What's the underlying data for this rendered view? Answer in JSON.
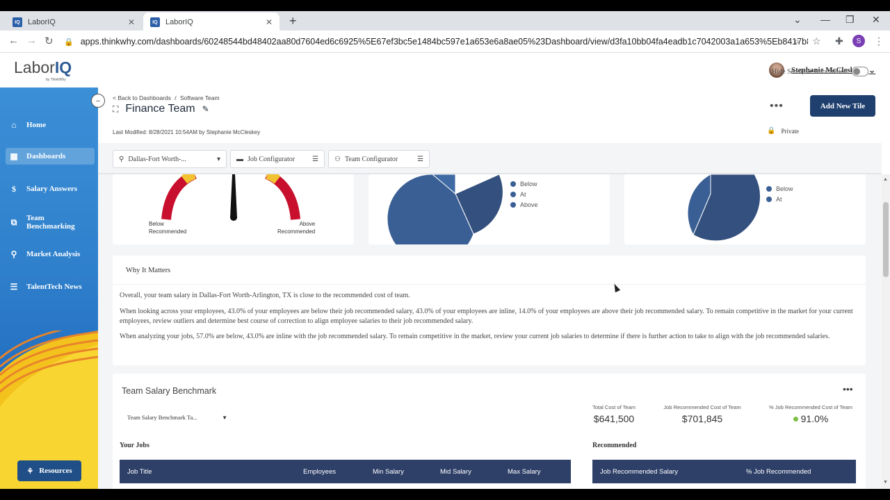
{
  "browser": {
    "tabs": [
      {
        "title": "LaborIQ",
        "favicon": "IQ",
        "close": "✕"
      },
      {
        "title": "LaborIQ",
        "favicon": "IQ",
        "close": "✕"
      }
    ],
    "new_tab": "+",
    "url": "apps.thinkwhy.com/dashboards/60248544bd48402aa80d7604ed6c6925%5E67ef3bc5e1484bc597e1a653e6a8ae05%23Dashboard/view/d3fa10bb04fa4eadb1c7042003a1a653%5Eb8417b8192804...",
    "profile_initial": "S"
  },
  "app": {
    "logo_text": "Labor",
    "logo_accent": "IQ",
    "logo_tagline": "by ThinkWhy",
    "user_name": "Stephanie McCleskey"
  },
  "sidebar": {
    "items": [
      {
        "label": "Home",
        "icon": "home-icon"
      },
      {
        "label": "Dashboards",
        "icon": "dashboard-icon"
      },
      {
        "label": "Salary Answers",
        "icon": "salary-icon"
      },
      {
        "label": "Team Benchmarking",
        "icon": "chart-icon"
      },
      {
        "label": "Market Analysis",
        "icon": "map-pin-icon"
      },
      {
        "label": "TalentTech News",
        "icon": "news-icon"
      }
    ],
    "resources_label": "Resources"
  },
  "page": {
    "back_link": "< Back to Dashboards",
    "crumb_sep": "/",
    "crumb_current": "Software Team",
    "title": "Finance Team",
    "last_modified": "Last Modified: 8/28/2021 10:54AM by Stephanie McCleskey",
    "add_tile_label": "Add New Tile",
    "private_label": "Private"
  },
  "filters": {
    "location": "Dallas-Fort Worth-...",
    "job_configurator": "Job Configurator",
    "team_configurator": "Team Configurator",
    "hide_sensitive": "Hide Sensitive Information"
  },
  "gauge": {
    "below_label_1": "Below",
    "below_label_2": "Recommended",
    "above_label_1": "Above",
    "above_label_2": "Recommended"
  },
  "pie1": {
    "legend": [
      "Below",
      "At",
      "Above"
    ]
  },
  "pie2": {
    "legend": [
      "Below",
      "At"
    ]
  },
  "why": {
    "heading": "Why It Matters",
    "p1": "Overall, your team salary in Dallas-Fort Worth-Arlington, TX is close to the recommended cost of team.",
    "p2": "When looking across your employees, 43.0% of your employees are below their job recommended salary, 43.0% of your employees are inline, 14.0% of your employees are above their job recommended salary. To remain competitive in the market for your current employees, review outliers and determine best course of correction to align employee salaries to their job recommended salary.",
    "p3": "When analyzing your jobs, 57.0% are below, 43.0% are inline with the job recommended salary. To remain competitive in the market, review your current job salaries to determine if there is further action to take to align with the job recommended salaries."
  },
  "benchmark": {
    "title": "Team Salary Benchmark",
    "select_value": "Team Salary Benchmark Ta...",
    "stats": [
      {
        "label": "Total Cost of Team",
        "value": "$641,500"
      },
      {
        "label": "Job Recommended Cost of Team",
        "value": "$701,845"
      },
      {
        "label": "% Job Recommended Cost of Team",
        "value": "91.0%"
      }
    ],
    "your_jobs": "Your Jobs",
    "recommended": "Recommended",
    "jobs_columns": [
      "Job Title",
      "Employees",
      "Min Salary",
      "Mid Salary",
      "Max Salary"
    ],
    "rec_columns": [
      "Job Recommended Salary",
      "% Job Recommended"
    ]
  },
  "colors": {
    "sidebar": "#2f80cc",
    "primary": "#1f3f6e",
    "pie": "#34507e",
    "table_header": "#2e4068",
    "gauge_red": "#c8102e",
    "gauge_yellow": "#f2c230"
  }
}
